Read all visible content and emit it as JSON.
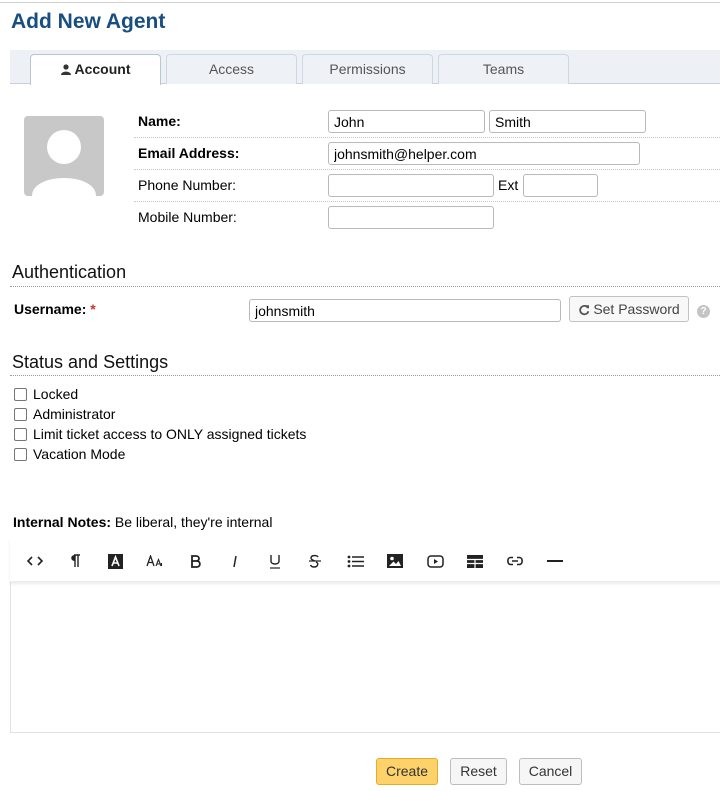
{
  "page_title": "Add New Agent",
  "tabs": [
    {
      "label": "Account",
      "icon": "user-icon",
      "active": true
    },
    {
      "label": "Access",
      "active": false
    },
    {
      "label": "Permissions",
      "active": false
    },
    {
      "label": "Teams",
      "active": false
    }
  ],
  "account": {
    "name_label": "Name:",
    "first_name": "John",
    "last_name": "Smith",
    "email_label": "Email Address:",
    "email": "johnsmith@helper.com",
    "phone_label": "Phone Number:",
    "phone": "",
    "ext_label": "Ext",
    "ext": "",
    "mobile_label": "Mobile Number:",
    "mobile": ""
  },
  "authentication": {
    "section_title": "Authentication",
    "username_label": "Username:",
    "required_mark": "*",
    "username": "johnsmith",
    "set_password_label": "Set Password",
    "help_glyph": "?"
  },
  "status_settings": {
    "section_title": "Status and Settings",
    "options": [
      {
        "label": "Locked",
        "checked": false
      },
      {
        "label": "Administrator",
        "checked": false
      },
      {
        "label": "Limit ticket access to ONLY assigned tickets",
        "checked": false
      },
      {
        "label": "Vacation Mode",
        "checked": false
      }
    ]
  },
  "notes": {
    "label": "Internal Notes:",
    "hint": "Be liberal, they're internal",
    "toolbar": [
      "code-view-icon",
      "paragraph-icon",
      "text-color-icon",
      "font-size-icon",
      "bold-icon",
      "italic-icon",
      "underline-icon",
      "strikethrough-icon",
      "unordered-list-icon",
      "insert-image-icon",
      "insert-video-icon",
      "insert-table-icon",
      "insert-link-icon",
      "horizontal-rule-icon"
    ],
    "body": ""
  },
  "actions": {
    "create": "Create",
    "reset": "Reset",
    "cancel": "Cancel"
  },
  "colors": {
    "title": "#184e81",
    "primary_button": "#fdd26a",
    "required": "#c0392b"
  }
}
